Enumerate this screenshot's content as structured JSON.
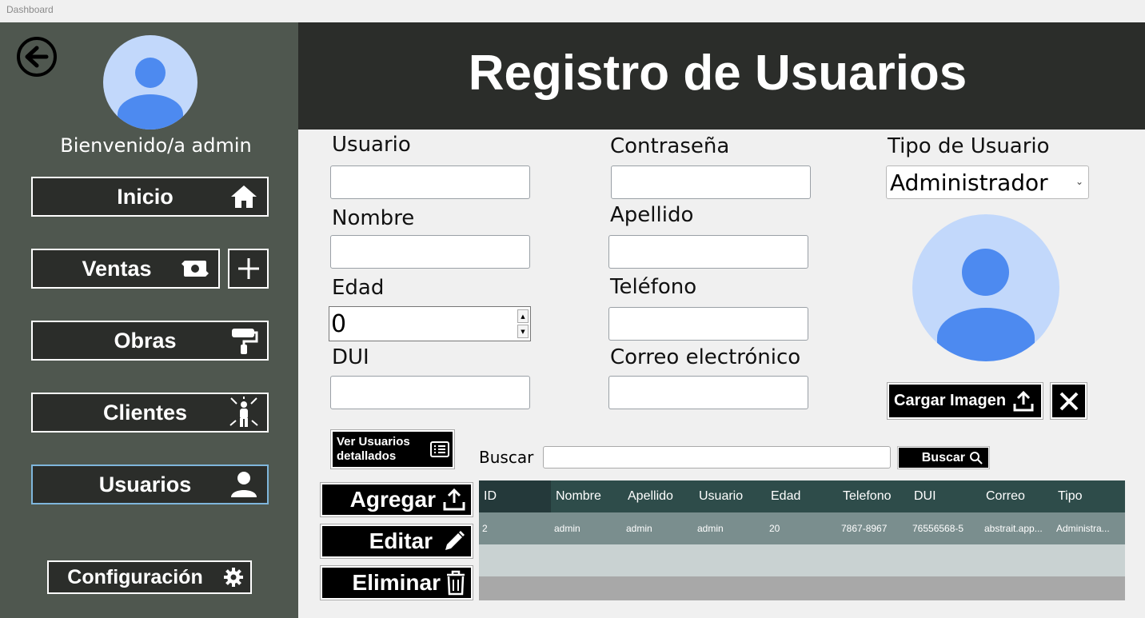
{
  "window": {
    "title": "Dashboard"
  },
  "sidebar": {
    "welcome": "Bienvenido/a admin",
    "nav": {
      "inicio": "Inicio",
      "ventas": "Ventas",
      "obras": "Obras",
      "clientes": "Clientes",
      "usuarios": "Usuarios",
      "configuracion": "Configuración"
    }
  },
  "header": {
    "title": "Registro de Usuarios"
  },
  "form": {
    "usuario_label": "Usuario",
    "contrasena_label": "Contraseña",
    "tipo_label": "Tipo de Usuario",
    "tipo_value": "Administrador",
    "nombre_label": "Nombre",
    "apellido_label": "Apellido",
    "edad_label": "Edad",
    "edad_value": "0",
    "telefono_label": "Teléfono",
    "dui_label": "DUI",
    "correo_label": "Correo electrónico",
    "cargar_imagen": "Cargar Imagen"
  },
  "actions": {
    "ver_usuarios_line1": "Ver Usuarios",
    "ver_usuarios_line2": "detallados",
    "buscar_label": "Buscar",
    "buscar_button": "Buscar",
    "agregar": "Agregar",
    "editar": "Editar",
    "eliminar": "Eliminar"
  },
  "table": {
    "headers": [
      "ID",
      "Nombre",
      "Apellido",
      "Usuario",
      "Edad",
      "Telefono",
      "DUI",
      "Correo",
      "Tipo"
    ],
    "rows": [
      [
        "2",
        "admin",
        "admin",
        "admin",
        "20",
        "7867-8967",
        "76556568-5",
        "abstrait.app...",
        "Administra..."
      ]
    ]
  },
  "colors": {
    "sidebar_bg": "#4f574f",
    "header_bg": "#2b2d2a",
    "avatar_bg": "#c2d8fb",
    "avatar_fg": "#4d8af0",
    "table_header": "#2e4c4a"
  }
}
